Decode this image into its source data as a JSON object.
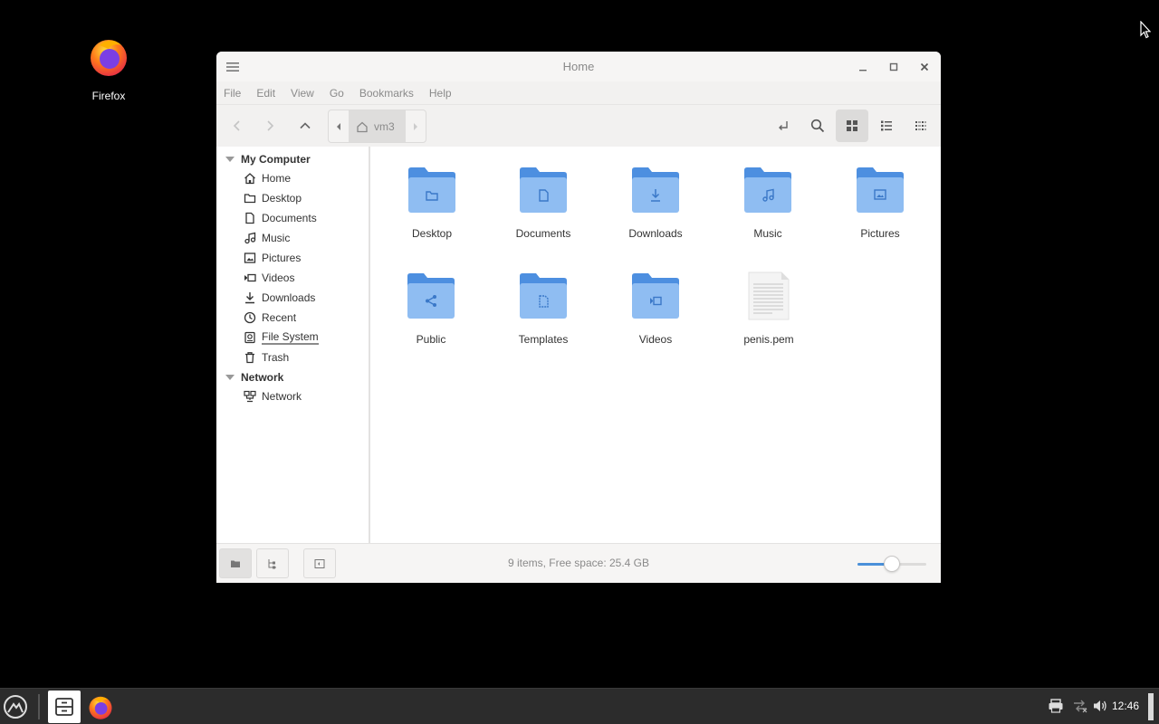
{
  "desktop": {
    "icons": [
      {
        "label": "Firefox",
        "icon": "firefox-icon"
      }
    ]
  },
  "window": {
    "title": "Home",
    "menu": [
      "File",
      "Edit",
      "View",
      "Go",
      "Bookmarks",
      "Help"
    ],
    "path": {
      "crumb": "vm3"
    },
    "sidebar": {
      "sections": [
        {
          "header": "My Computer",
          "items": [
            {
              "label": "Home",
              "icon": "home-icon"
            },
            {
              "label": "Desktop",
              "icon": "folder-icon"
            },
            {
              "label": "Documents",
              "icon": "document-icon"
            },
            {
              "label": "Music",
              "icon": "music-icon"
            },
            {
              "label": "Pictures",
              "icon": "picture-icon"
            },
            {
              "label": "Videos",
              "icon": "video-icon"
            },
            {
              "label": "Downloads",
              "icon": "download-icon"
            },
            {
              "label": "Recent",
              "icon": "clock-icon"
            },
            {
              "label": "File System",
              "icon": "drive-icon"
            },
            {
              "label": "Trash",
              "icon": "trash-icon"
            }
          ]
        },
        {
          "header": "Network",
          "items": [
            {
              "label": "Network",
              "icon": "network-icon"
            }
          ]
        }
      ]
    },
    "files": [
      {
        "name": "Desktop",
        "type": "folder",
        "emblem": "folder"
      },
      {
        "name": "Documents",
        "type": "folder",
        "emblem": "document"
      },
      {
        "name": "Downloads",
        "type": "folder",
        "emblem": "download"
      },
      {
        "name": "Music",
        "type": "folder",
        "emblem": "music"
      },
      {
        "name": "Pictures",
        "type": "folder",
        "emblem": "picture"
      },
      {
        "name": "Public",
        "type": "folder",
        "emblem": "share"
      },
      {
        "name": "Templates",
        "type": "folder",
        "emblem": "template"
      },
      {
        "name": "Videos",
        "type": "folder",
        "emblem": "video"
      },
      {
        "name": "penis.pem",
        "type": "file",
        "emblem": "text"
      }
    ],
    "status": "9 items, Free space: 25.4 GB",
    "zoom_level": 0.5
  },
  "taskbar": {
    "clock": "12:46"
  },
  "colors": {
    "folder_back": "#4d8fe0",
    "folder_front": "#8fbdf2",
    "accent": "#4a90d9",
    "taskbar": "#2c2c2c"
  }
}
